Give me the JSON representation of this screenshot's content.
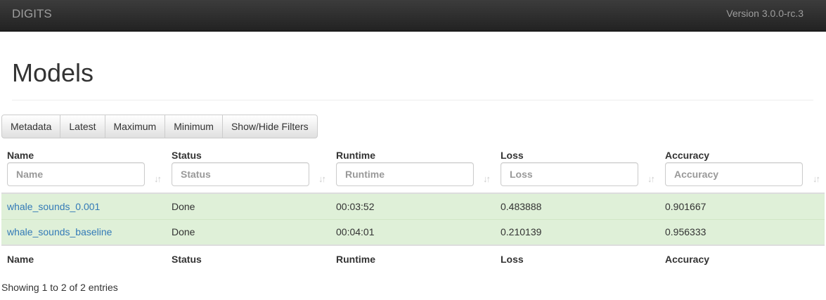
{
  "navbar": {
    "brand": "DIGITS",
    "version": "Version 3.0.0-rc.3"
  },
  "page": {
    "title": "Models"
  },
  "toolbar": {
    "buttons": [
      "Metadata",
      "Latest",
      "Maximum",
      "Minimum",
      "Show/Hide Filters"
    ]
  },
  "table": {
    "columns": [
      {
        "label": "Name",
        "placeholder": "Name"
      },
      {
        "label": "Status",
        "placeholder": "Status"
      },
      {
        "label": "Runtime",
        "placeholder": "Runtime"
      },
      {
        "label": "Loss",
        "placeholder": "Loss"
      },
      {
        "label": "Accuracy",
        "placeholder": "Accuracy"
      }
    ],
    "sort_icon": "sort-icon",
    "rows": [
      {
        "name": "whale_sounds_0.001",
        "status": "Done",
        "runtime": "00:03:52",
        "loss": "0.483888",
        "accuracy": "0.901667"
      },
      {
        "name": "whale_sounds_baseline",
        "status": "Done",
        "runtime": "00:04:01",
        "loss": "0.210139",
        "accuracy": "0.956333"
      }
    ],
    "row_color": "#dff0d8",
    "link_color": "#337ab7"
  },
  "info": "Showing 1 to 2 of 2 entries"
}
